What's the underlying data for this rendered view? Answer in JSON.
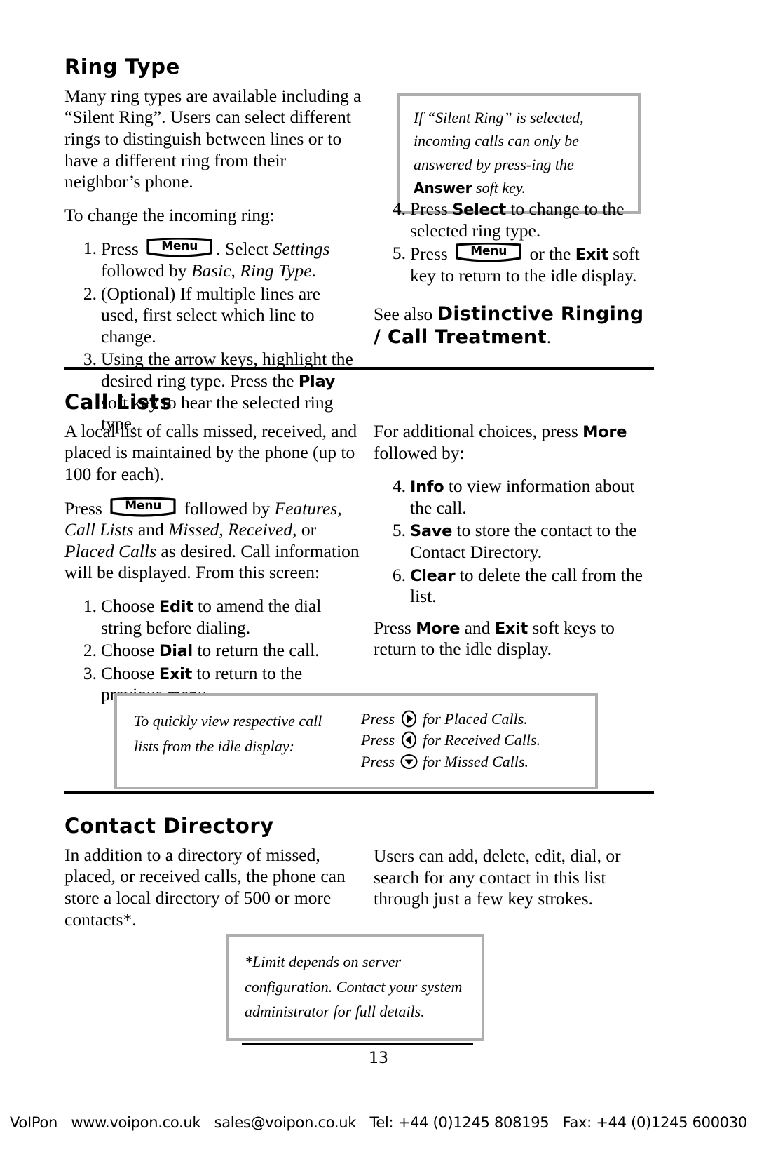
{
  "document": {
    "page_number": "13"
  },
  "sections": {
    "ring_type": {
      "heading": "Ring Type",
      "intro": "Many ring types are available including a “Silent Ring”.  Users can select different rings to distinguish between lines or to have a different ring from their neighbor’s phone.",
      "lead": "To change the incoming ring:",
      "note": {
        "text_before_key": "If “Silent Ring” is selected, incoming calls can only be answered by press-ing the ",
        "key": "Answer",
        "text_after_key": " soft key."
      },
      "steps_left": [
        {
          "num": "1.",
          "before_key": "Press ",
          "menu_key": "Menu",
          "after_key_plain": ".  Select ",
          "italic_1": "Settings",
          "mid": " followed by ",
          "italic_2": "Basic, Ring Type",
          "tail": "."
        },
        {
          "num": "2.",
          "text": "(Optional)  If multiple lines are used, first select which line to change."
        },
        {
          "num": "3.",
          "before_key": "Using the arrow keys, highlight the desired ring type.  Press the ",
          "key": "Play",
          "after_key": " soft key to hear the selected ring type."
        }
      ],
      "steps_right": [
        {
          "num": "4.",
          "before_key": "Press ",
          "key": "Select",
          "after_key": " to change to the selected ring type."
        },
        {
          "num": "5.",
          "before_key": "Press ",
          "menu_key": "Menu",
          "mid": " or the ",
          "key": "Exit",
          "after_key": " soft key to return to the idle display."
        }
      ],
      "see_also": {
        "prefix": "See also ",
        "target": "Distinctive Ringing / Call Treatment",
        "suffix": "."
      }
    },
    "call_lists": {
      "heading": "Call Lists",
      "intro": "A local list of calls missed, received, and placed is maintained by the phone (up to 100 for each).",
      "press_paragraph": {
        "before_key": "Press ",
        "menu_key": "Menu",
        "after_key": " followed by ",
        "italic_1": "Features, Call Lists",
        "mid_1": " and ",
        "italic_2": "Missed",
        "mid_2": ", ",
        "italic_3": "Received",
        "mid_3": ", or ",
        "italic_4": "Placed Calls",
        "tail": " as desired.  Call information will be displayed.  From this screen:"
      },
      "steps_left": [
        {
          "num": "1.",
          "before_key": "Choose ",
          "key": "Edit",
          "after_key": " to amend the dial string before dialing."
        },
        {
          "num": "2.",
          "before_key": "Choose ",
          "key": "Dial",
          "after_key": " to return the call."
        },
        {
          "num": "3.",
          "before_key": "Choose ",
          "key": "Exit",
          "after_key": " to return to the previous menu."
        }
      ],
      "right_intro": {
        "before_key": "For additional choices, press ",
        "key": "More",
        "after_key": " followed by:"
      },
      "steps_right": [
        {
          "num": "4.",
          "key": "Info",
          "after_key": " to view information about the call."
        },
        {
          "num": "5.",
          "key": "Save",
          "after_key": " to store the contact to the Contact Directory."
        },
        {
          "num": "6.",
          "key": "Clear",
          "after_key": " to delete the call from the list."
        }
      ],
      "closing": {
        "before_key1": "Press ",
        "key1": "More",
        "mid": " and ",
        "key2": "Exit",
        "after_key2": " soft keys to return to the idle display."
      },
      "note": {
        "left_text": "To quickly view respective call lists from the idle display:",
        "rows": [
          {
            "before": "Press ",
            "icon": "arrow-right-icon",
            "after": " for Placed Calls."
          },
          {
            "before": "Press ",
            "icon": "arrow-left-icon",
            "after": " for Received Calls."
          },
          {
            "before": "Press ",
            "icon": "arrow-down-icon",
            "after": " for Missed Calls."
          }
        ]
      }
    },
    "contact_directory": {
      "heading": "Contact Directory",
      "left_text": "In addition to a directory of missed, placed, or received calls, the phone can store a local directory of 500 or more contacts*.",
      "right_text": "Users can add, delete, edit, dial, or search for any contact in this list through just a few key strokes.",
      "note": "*Limit depends on server configuration.  Contact your system administrator for full details."
    }
  },
  "footer": {
    "brand": "VoIPon",
    "website": "www.voipon.co.uk",
    "email": "sales@voipon.co.uk",
    "tel": "Tel: +44 (0)1245 808195",
    "fax": "Fax: +44 (0)1245 600030"
  }
}
